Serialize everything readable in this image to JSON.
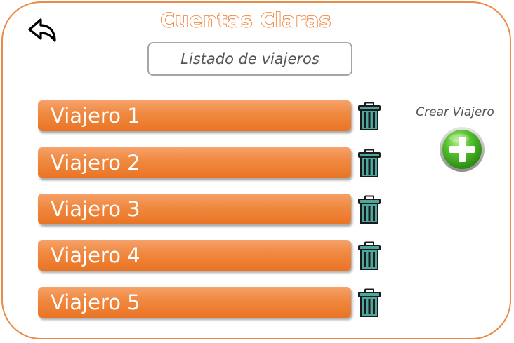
{
  "header": {
    "title": "Cuentas Claras",
    "subtitle": "Listado de viajeros"
  },
  "travelers": [
    {
      "label": "Viajero 1"
    },
    {
      "label": "Viajero 2"
    },
    {
      "label": "Viajero 3"
    },
    {
      "label": "Viajero 4"
    },
    {
      "label": "Viajero 5"
    }
  ],
  "create": {
    "label": "Crear Viajero"
  },
  "icons": {
    "back": "back-arrow-icon",
    "delete": "trash-icon",
    "create": "plus-circle-icon"
  },
  "colors": {
    "frame": "#e98a46",
    "title_outline": "#ee7a2a",
    "traveler_button": "#f08a42",
    "trash": "#4ea79d",
    "create_button": "#3fae2a"
  }
}
